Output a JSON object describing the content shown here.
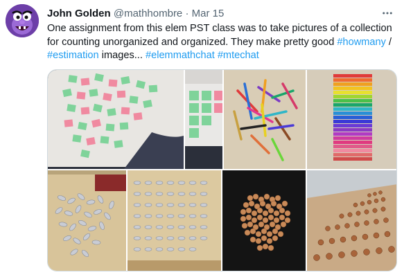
{
  "tweet": {
    "display_name": "John Golden",
    "handle": "@mathhombre",
    "separator": "·",
    "date": "Mar 15",
    "text_main": "One assignment from this elem PST class was to take pictures of a collection for counting unorganized and organized. They make pretty good ",
    "hashtags": [
      "#howmany",
      "#estimation",
      "#elemmathchat",
      "#mtechat"
    ],
    "slash": " / ",
    "images_word": " images... ",
    "space": " "
  },
  "icons": {
    "avatar": "count-puppet-avatar",
    "more": "more-dots-icon"
  },
  "colors": {
    "link": "#1d9bf0",
    "secondary_text": "#536471",
    "avatar_bg": "#6d3fa8"
  },
  "media": {
    "photos": [
      "sticky-notes-unorganized",
      "sticky-notes-organized",
      "markers-unorganized",
      "markers-organized",
      "foil-pieces-unorganized",
      "foil-pieces-organized",
      "pennies-unorganized",
      "pennies-organized"
    ]
  }
}
